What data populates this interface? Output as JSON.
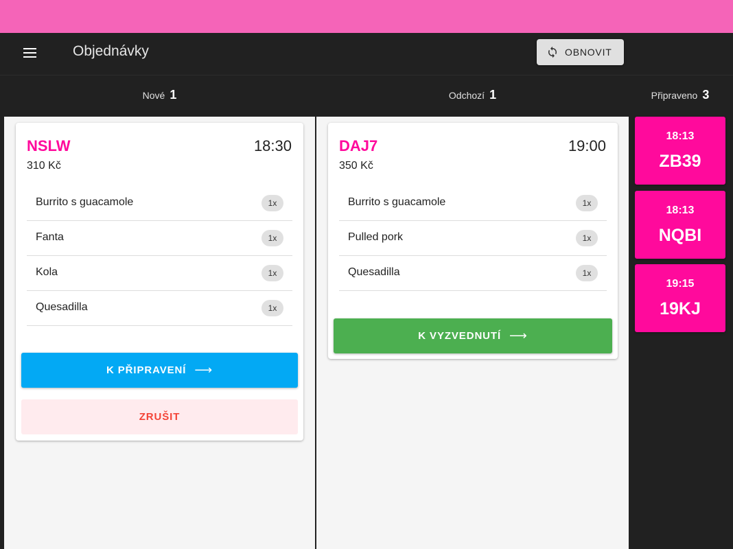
{
  "app": {
    "title": "Objednávky",
    "menu_icon": "menu-icon",
    "refresh_label": "OBNOVIT",
    "refresh_icon": "refresh-icon"
  },
  "colors": {
    "accent": "#ff0a9c",
    "status_bar": "#f564b8",
    "prepare_button": "#03a9f4",
    "pickup_button": "#4caf50",
    "cancel_text": "#f44336"
  },
  "columns": {
    "new": {
      "label": "Nové",
      "count": "1"
    },
    "outgoing": {
      "label": "Odchozí",
      "count": "1"
    },
    "ready": {
      "label": "Připraveno",
      "count": "3"
    }
  },
  "new_orders": [
    {
      "code": "NSLW",
      "time": "18:30",
      "price": "310 Kč",
      "items": [
        {
          "name": "Burrito s guacamole",
          "qty": "1x"
        },
        {
          "name": "Fanta",
          "qty": "1x"
        },
        {
          "name": "Kola",
          "qty": "1x"
        },
        {
          "name": "Quesadilla",
          "qty": "1x"
        }
      ],
      "action_label": "K PŘIPRAVENÍ",
      "action_arrow": "⟶",
      "cancel_label": "ZRUŠIT"
    }
  ],
  "outgoing_orders": [
    {
      "code": "DAJ7",
      "time": "19:00",
      "price": "350 Kč",
      "items": [
        {
          "name": "Burrito s guacamole",
          "qty": "1x"
        },
        {
          "name": "Pulled pork",
          "qty": "1x"
        },
        {
          "name": "Quesadilla",
          "qty": "1x"
        }
      ],
      "action_label": "K VYZVEDNUTÍ",
      "action_arrow": "⟶"
    }
  ],
  "ready_orders": [
    {
      "time": "18:13",
      "code": "ZB39"
    },
    {
      "time": "18:13",
      "code": "NQBI"
    },
    {
      "time": "19:15",
      "code": "19KJ"
    }
  ]
}
